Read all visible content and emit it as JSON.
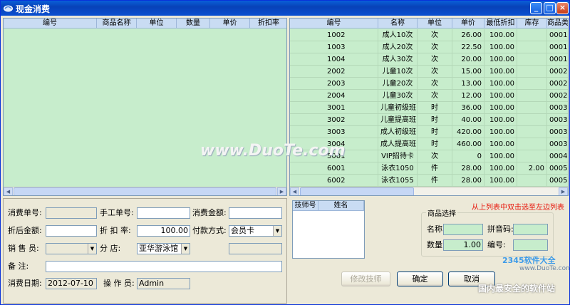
{
  "window": {
    "title": "现金消费",
    "minimize": "_",
    "maximize": "□",
    "close": "×"
  },
  "left_grid": {
    "columns": [
      "编号",
      "商品名称",
      "单位",
      "数量",
      "单价",
      "折扣率"
    ]
  },
  "right_grid": {
    "columns": [
      "编号",
      "名称",
      "单位",
      "单价",
      "最低折扣",
      "库存",
      "商品类"
    ],
    "rows": [
      {
        "code": "1002",
        "name": "成人10次",
        "unit": "次",
        "price": "26.00",
        "min_discount": "100.00",
        "stock": "",
        "category": "0001"
      },
      {
        "code": "1003",
        "name": "成人20次",
        "unit": "次",
        "price": "22.50",
        "min_discount": "100.00",
        "stock": "",
        "category": "0001"
      },
      {
        "code": "1004",
        "name": "成人30次",
        "unit": "次",
        "price": "20.00",
        "min_discount": "100.00",
        "stock": "",
        "category": "0001"
      },
      {
        "code": "2002",
        "name": "儿童10次",
        "unit": "次",
        "price": "15.00",
        "min_discount": "100.00",
        "stock": "",
        "category": "0002"
      },
      {
        "code": "2003",
        "name": "儿童20次",
        "unit": "次",
        "price": "13.00",
        "min_discount": "100.00",
        "stock": "",
        "category": "0002"
      },
      {
        "code": "2004",
        "name": "儿童30次",
        "unit": "次",
        "price": "12.00",
        "min_discount": "100.00",
        "stock": "",
        "category": "0002"
      },
      {
        "code": "3001",
        "name": "儿童初级班",
        "unit": "时",
        "price": "36.00",
        "min_discount": "100.00",
        "stock": "",
        "category": "0003"
      },
      {
        "code": "3002",
        "name": "儿童提高班",
        "unit": "时",
        "price": "40.00",
        "min_discount": "100.00",
        "stock": "",
        "category": "0003"
      },
      {
        "code": "3003",
        "name": "成人初级班",
        "unit": "时",
        "price": "420.00",
        "min_discount": "100.00",
        "stock": "",
        "category": "0003"
      },
      {
        "code": "3004",
        "name": "成人提高班",
        "unit": "时",
        "price": "460.00",
        "min_discount": "100.00",
        "stock": "",
        "category": "0003"
      },
      {
        "code": "5001",
        "name": "VIP招待卡",
        "unit": "次",
        "price": "0",
        "min_discount": "100.00",
        "stock": "",
        "category": "0004"
      },
      {
        "code": "6001",
        "name": "泳衣1050",
        "unit": "件",
        "price": "28.00",
        "min_discount": "100.00",
        "stock": "2.00",
        "category": "0005"
      },
      {
        "code": "6002",
        "name": "泳衣1055",
        "unit": "件",
        "price": "28.00",
        "min_discount": "100.00",
        "stock": "",
        "category": "0005"
      }
    ]
  },
  "form": {
    "order_no_label": "消费单号:",
    "order_no_value": "",
    "manual_no_label": "手工单号:",
    "manual_no_value": "",
    "amount_label": "消费金额:",
    "amount_value": "",
    "discounted_label": "折后金额:",
    "discounted_value": "",
    "discount_rate_label": "折 扣 率:",
    "discount_rate_value": "100.00",
    "payment_label": "付款方式:",
    "payment_value": "会员卡",
    "salesperson_label": "销 售 员:",
    "salesperson_value": "",
    "branch_label": "分    店:",
    "branch_value": "亚华游泳馆",
    "remark_label": "备    注:",
    "remark_value": "",
    "date_label": "消费日期:",
    "date_value": "2012-07-10",
    "operator_label": "操 作 员:",
    "operator_value": "Admin"
  },
  "tech_grid": {
    "columns": [
      "技师号",
      "姓名"
    ]
  },
  "hint": "从上列表中双击选至左边列表",
  "product_select": {
    "title": "商品选择",
    "name_label": "名称:",
    "name_value": "",
    "pinyin_label": "拼音码:",
    "pinyin_value": "",
    "qty_label": "数量:",
    "qty_value": "1.00",
    "code_label": "编号:",
    "code_value": ""
  },
  "buttons": {
    "modify_tech": "修改技师",
    "confirm": "确定",
    "cancel": "取消"
  },
  "watermarks": {
    "center": "www.DuoTe.com",
    "corner_brand": "2345软件大全",
    "corner_url": "www.DuoTe.com",
    "corner_slogan": "国内最安全的软件站"
  },
  "colors": {
    "title_bar": "#0a5fd8",
    "grid_bg": "#c7edcc",
    "header_bg": "#c9dcf3",
    "hint": "#e8170c"
  }
}
